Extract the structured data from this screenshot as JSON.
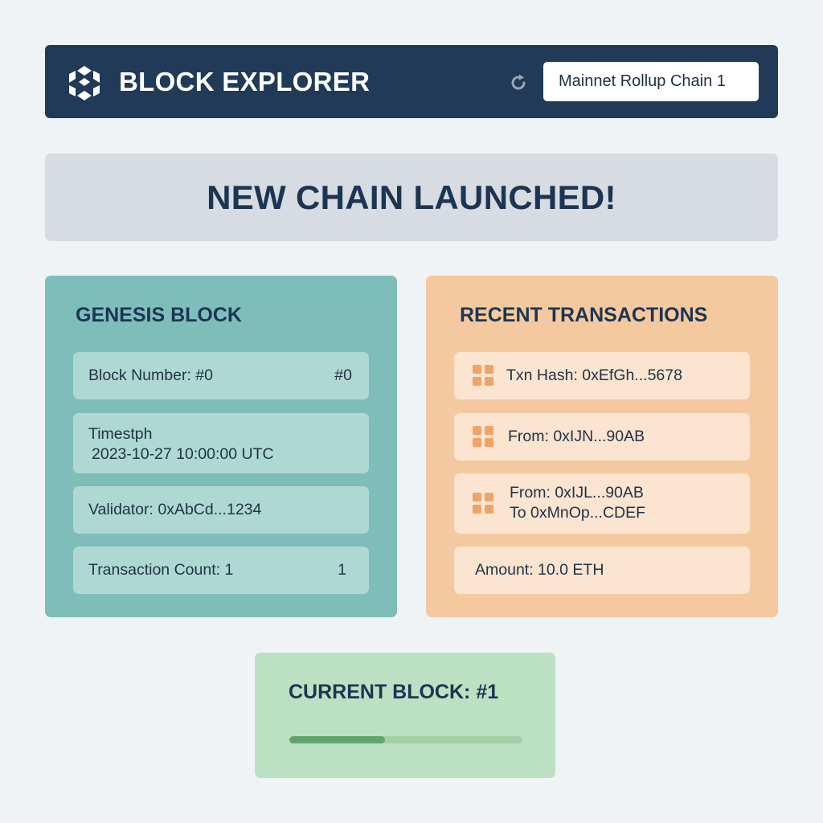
{
  "header": {
    "app_title": "BLOCK EXPLORER",
    "logo_icon": "snowflake-cube-logo",
    "refresh_icon": "refresh-icon",
    "network_select_value": "Mainnet Rollup Chain 1"
  },
  "banner": {
    "text": "NEW CHAIN LAUNCHED!"
  },
  "genesis": {
    "title": "GENESIS BLOCK",
    "block_number_label": "Block Number: #0",
    "block_number_value": "#0",
    "timestamp_label": "Timestph",
    "timestamp_value": "2023-10-27 10:00:00 UTC",
    "validator_label": "Validator: 0xAbCd...1234",
    "tx_count_label": "Transaction Count: 1",
    "tx_count_value": "1"
  },
  "transactions": {
    "title": "RECENT TRANSACTIONS",
    "item_icon": "grid-icon",
    "items": [
      {
        "line1": "Txn Hash: 0xEfGh...5678"
      },
      {
        "line1": "From: 0xIJN...90AB"
      },
      {
        "line1": "From: 0xIJL...90AB",
        "line2": "To 0xMnOp...CDEF"
      }
    ],
    "amount_label": "Amount: 10.0 ETH"
  },
  "current_block": {
    "title": "CURRENT BLOCK: #1",
    "progress_fraction": 0.41
  },
  "colors": {
    "header_bg": "#203a58",
    "banner_bg": "#d6dce2",
    "genesis_bg": "#7fbdba",
    "tx_bg": "#f5c9a0",
    "current_bg": "#bce0c2",
    "progress_fill": "#62a36c",
    "accent_orange": "#f0a367"
  }
}
